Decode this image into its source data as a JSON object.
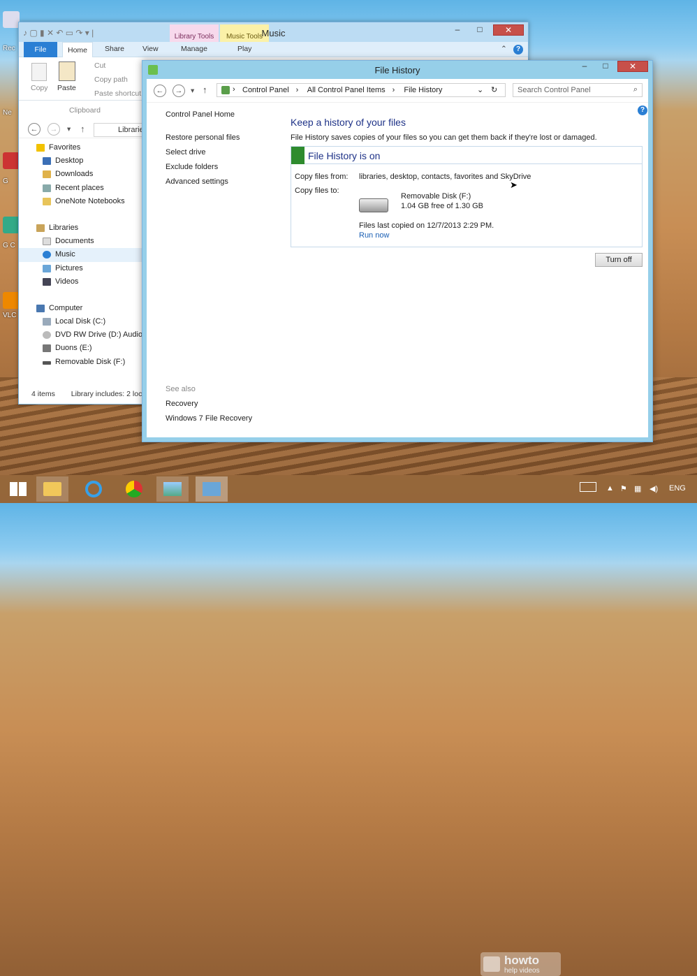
{
  "desktop": {
    "icon_labels": [
      "Rec",
      "Ne",
      "G",
      "G C",
      "VLC"
    ]
  },
  "explorer": {
    "title": "Music",
    "context_tabs": [
      "Library Tools",
      "Music Tools"
    ],
    "context_sub_tabs": [
      "Manage",
      "Play"
    ],
    "tabs": [
      "File",
      "Home",
      "Share",
      "View"
    ],
    "ribbon": {
      "copy": "Copy",
      "paste": "Paste",
      "cut": "Cut",
      "copy_path": "Copy path",
      "paste_shortcut": "Paste shortcut",
      "group": "Clipboard"
    },
    "address": "Librarie",
    "tree": {
      "favorites": {
        "label": "Favorites",
        "items": [
          "Desktop",
          "Downloads",
          "Recent places",
          "OneNote Notebooks"
        ]
      },
      "libraries": {
        "label": "Libraries",
        "items": [
          "Documents",
          "Music",
          "Pictures",
          "Videos"
        ]
      },
      "computer": {
        "label": "Computer",
        "items": [
          "Local Disk (C:)",
          "DVD RW Drive (D:) Audio",
          "Duons (E:)",
          "Removable Disk (F:)"
        ]
      }
    },
    "status": {
      "items": "4 items",
      "library": "Library includes: 2 loc"
    }
  },
  "file_history": {
    "title": "File History",
    "breadcrumb": [
      "Control Panel",
      "All Control Panel Items",
      "File History"
    ],
    "search_placeholder": "Search Control Panel",
    "left_nav": {
      "home": "Control Panel Home",
      "links": [
        "Restore personal files",
        "Select drive",
        "Exclude folders",
        "Advanced settings"
      ],
      "see_also": "See also",
      "see_also_links": [
        "Recovery",
        "Windows 7 File Recovery"
      ]
    },
    "heading": "Keep a history of your files",
    "description": "File History saves copies of your files so you can get them back if they're lost or damaged.",
    "status_title": "File History is on",
    "copy_from_label": "Copy files from:",
    "copy_from_value": "libraries, desktop, contacts, favorites and SkyDrive",
    "copy_to_label": "Copy files to:",
    "drive_name": "Removable Disk (F:)",
    "drive_space": "1.04 GB free of 1.30 GB",
    "last_copied": "Files last copied on 12/7/2013 2:29 PM.",
    "run_now": "Run now",
    "turn_off": "Turn off"
  },
  "taskbar": {
    "lang": "ENG",
    "watermark_line1": "howto",
    "watermark_line2": "help videos"
  },
  "colors": {
    "accent": "#2a7fd4",
    "status_green": "#2e8b2e",
    "heading_blue": "#1e3287",
    "close_red": "#c7504a"
  }
}
